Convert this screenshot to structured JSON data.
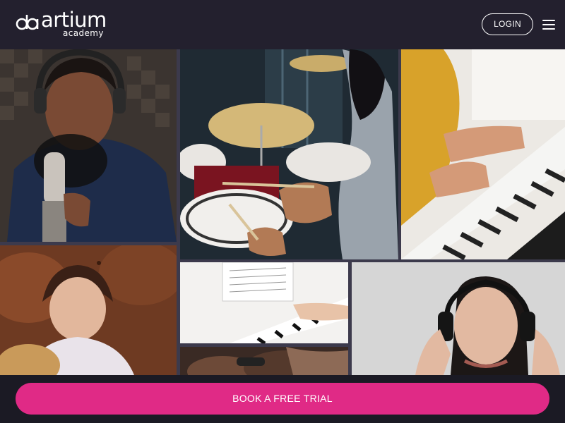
{
  "header": {
    "logo_text": "artium",
    "logo_subtext": "academy",
    "login_label": "LOGIN",
    "menu_icon": "hamburger-menu-icon"
  },
  "gallery": {
    "images": [
      "singer-with-headphones",
      "drummer-playing-drums",
      "child-playing-keyboard",
      "girl-with-guitar",
      "hands-playing-piano",
      "woman-with-headphones",
      "hands-on-instrument"
    ]
  },
  "cta": {
    "book_trial_label": "BOOK A FREE TRIAL"
  },
  "colors": {
    "header_bg": "#23202e",
    "cta_pink": "#e02a86",
    "bottom_bar": "#1b1a24"
  }
}
